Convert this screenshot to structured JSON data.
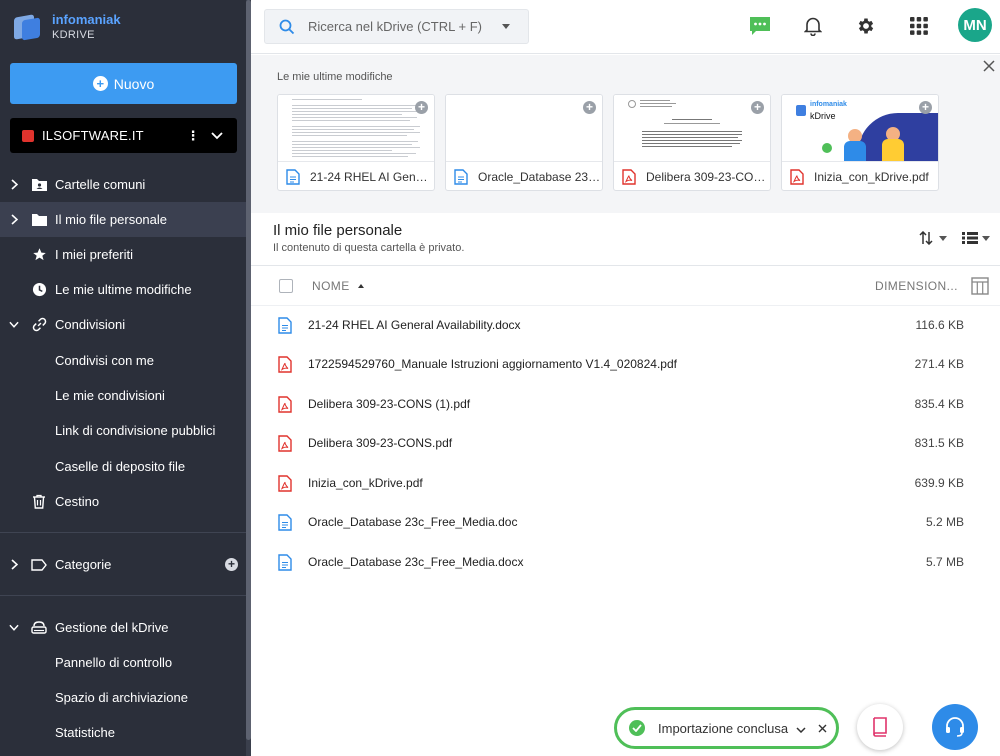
{
  "brand": {
    "name": "infomaniak",
    "product": "KDRIVE"
  },
  "sidebar": {
    "new_label": "Nuovo",
    "drive_name": "ILSOFTWARE.IT",
    "items": [
      {
        "label": "Cartelle comuni",
        "icon": "shared-folder-icon"
      },
      {
        "label": "Il mio file personale",
        "icon": "folder-icon"
      },
      {
        "label": "I miei preferiti",
        "icon": "star-icon"
      },
      {
        "label": "Le mie ultime modifiche",
        "icon": "clock-icon"
      },
      {
        "label": "Condivisioni",
        "icon": "link-icon"
      },
      {
        "label": "Condivisi con me"
      },
      {
        "label": "Le mie condivisioni"
      },
      {
        "label": "Link di condivisione pubblici"
      },
      {
        "label": "Caselle di deposito file"
      },
      {
        "label": "Cestino",
        "icon": "trash-icon"
      },
      {
        "label": "Categorie",
        "icon": "tag-icon"
      },
      {
        "label": "Gestione del kDrive",
        "icon": "drive-icon"
      },
      {
        "label": "Pannello di controllo"
      },
      {
        "label": "Spazio di archiviazione"
      },
      {
        "label": "Statistiche"
      }
    ]
  },
  "search": {
    "placeholder": "Ricerca nel kDrive (CTRL + F)"
  },
  "user": {
    "initials": "MN"
  },
  "recent": {
    "title": "Le mie ultime modifiche",
    "cards": [
      {
        "name": "21-24 RHEL AI General Availability.docx",
        "type": "doc"
      },
      {
        "name": "Oracle_Database 23c_Free_Media.docx",
        "type": "doc"
      },
      {
        "name": "Delibera 309-23-CONS.pdf",
        "type": "pdf"
      },
      {
        "name": "Inizia_con_kDrive.pdf",
        "type": "pdf",
        "thumb_brand": "infomaniak",
        "thumb_product": "kDrive"
      }
    ]
  },
  "folder": {
    "title": "Il mio file personale",
    "subtitle": "Il contenuto di questa cartella è privato."
  },
  "table": {
    "col_name": "NOME",
    "col_size": "DIMENSION...",
    "rows": [
      {
        "name": "21-24 RHEL AI General Availability.docx",
        "size": "116.6 KB",
        "type": "doc"
      },
      {
        "name": "1722594529760_Manuale Istruzioni aggiornamento V1.4_020824.pdf",
        "size": "271.4 KB",
        "type": "pdf"
      },
      {
        "name": "Delibera 309-23-CONS (1).pdf",
        "size": "835.4 KB",
        "type": "pdf"
      },
      {
        "name": "Delibera 309-23-CONS.pdf",
        "size": "831.5 KB",
        "type": "pdf"
      },
      {
        "name": "Inizia_con_kDrive.pdf",
        "size": "639.9 KB",
        "type": "pdf"
      },
      {
        "name": "Oracle_Database 23c_Free_Media.doc",
        "size": "5.2 MB",
        "type": "doc"
      },
      {
        "name": "Oracle_Database 23c_Free_Media.docx",
        "size": "5.7 MB",
        "type": "doc"
      }
    ]
  },
  "toast": {
    "message": "Importazione conclusa"
  },
  "colors": {
    "accent": "#3d9bf2",
    "sidebar": "#2b2f3a",
    "success": "#4fbf58",
    "pdf": "#e0332d",
    "doc": "#2e8be8",
    "avatar": "#1aa68a"
  }
}
